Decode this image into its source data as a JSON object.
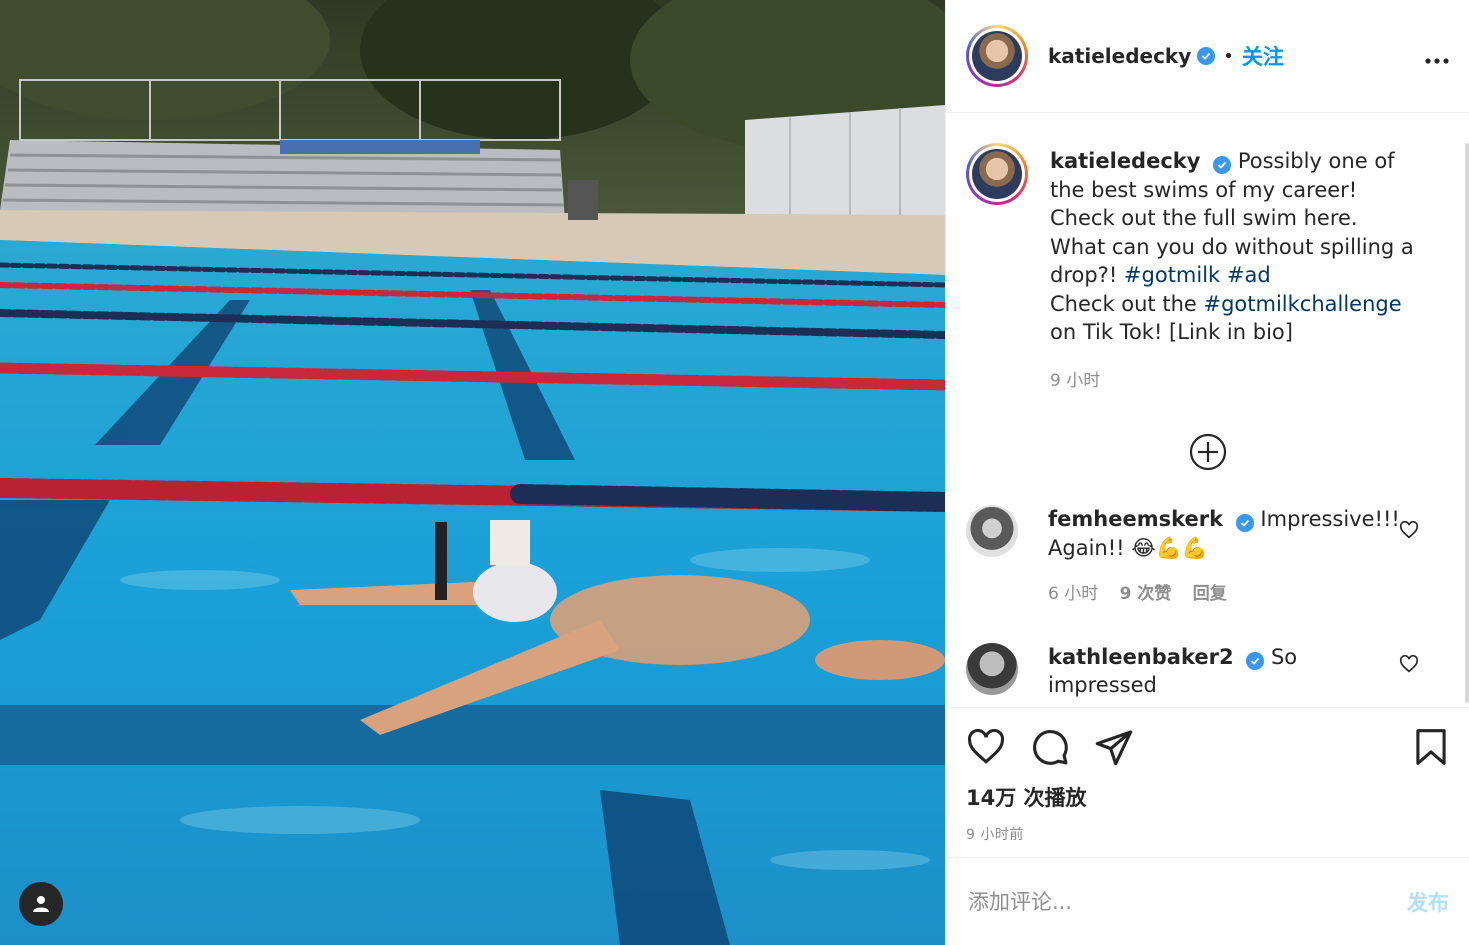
{
  "author": {
    "username": "katieledecky",
    "separator": "•",
    "follow_label": "关注",
    "more_label": "•••"
  },
  "caption": {
    "username": "katieledecky",
    "text_1": "Possibly one of the best swims of my career! Check out the full swim here. What can you do without spilling a drop?! ",
    "hashtag_1": "#gotmilk",
    "hashtag_2": "#ad",
    "text_2": "Check out the ",
    "hashtag_3": "#gotmilkchallenge",
    "text_3": " on Tik Tok! [Link in bio]",
    "time": "9 小时"
  },
  "comments": [
    {
      "username": "femheemskerk",
      "text": "Impressive!!! Again!! 😂💪💪",
      "time": "6 小时",
      "likes": "9 次赞",
      "reply_label": "回复"
    },
    {
      "username": "kathleenbaker2",
      "text": "So impressed"
    }
  ],
  "stats": {
    "views": "14万 次播放",
    "posted": "9 小时前"
  },
  "add_comment": {
    "placeholder": "添加评论...",
    "post_label": "发布"
  },
  "colors": {
    "accent": "#0095f6",
    "verified": "#3897f0",
    "post_disabled": "#b2dffc",
    "pool": "#1ea3d6"
  },
  "icons": [
    "user-tag-icon",
    "verified-icon",
    "more-options-icon",
    "load-more-icon",
    "heart-icon",
    "comment-icon",
    "share-icon",
    "bookmark-icon"
  ]
}
